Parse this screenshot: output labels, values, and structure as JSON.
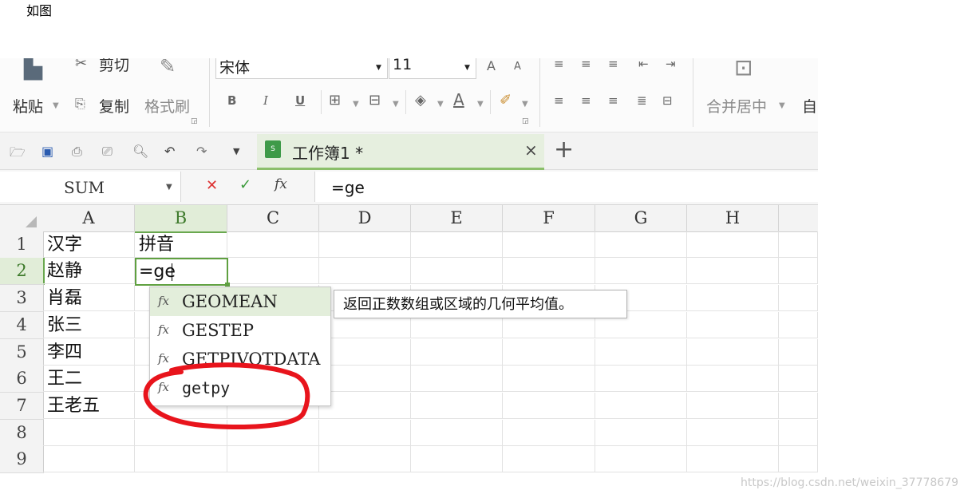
{
  "caption": "如图",
  "ribbon": {
    "paste": "粘贴",
    "cut": "剪切",
    "copy": "复制",
    "format_painter": "格式刷",
    "font_name": "宋体",
    "font_size": "11",
    "bold": "B",
    "italic": "I",
    "underline": "U",
    "font_color": "A",
    "font_grow": "A",
    "font_shrink": "A",
    "merge_center": "合并居中",
    "wrap": "自"
  },
  "tab": {
    "name": "工作簿1 *",
    "close": "×",
    "new_tab": "+"
  },
  "formula_bar": {
    "name_box": "SUM",
    "cancel": "✕",
    "confirm": "✓",
    "fx": "fx",
    "content": "=ge"
  },
  "sheet": {
    "columns": [
      "A",
      "B",
      "C",
      "D",
      "E",
      "F",
      "G",
      "H"
    ],
    "rows": [
      "1",
      "2",
      "3",
      "4",
      "5",
      "6",
      "7",
      "8",
      "9"
    ],
    "A": [
      "汉字",
      "赵静",
      "肖磊",
      "张三",
      "李四",
      "王二",
      "王老五"
    ],
    "B1": "拼音",
    "B2": "=ge"
  },
  "autocomplete": {
    "icon": "fx",
    "items": [
      "GEOMEAN",
      "GESTEP",
      "GETPIVOTDATA",
      "getpy"
    ],
    "tooltip": "返回正数数组或区域的几何平均值。"
  },
  "colors": {
    "accent": "#5fa040",
    "annotation": "#e8141c"
  },
  "watermark": "https://blog.csdn.net/weixin_37778679"
}
